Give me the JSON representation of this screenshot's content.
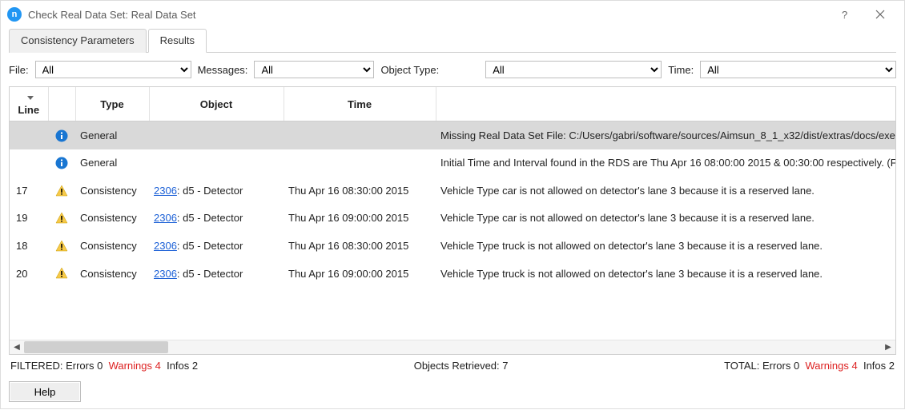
{
  "title": "Check Real Data Set: Real Data Set",
  "tabs": {
    "consistency": "Consistency Parameters",
    "results": "Results"
  },
  "filters": {
    "file_label": "File:",
    "file_value": "All",
    "messages_label": "Messages:",
    "messages_value": "All",
    "object_type_label": "Object Type:",
    "object_type_value": "All",
    "time_label": "Time:",
    "time_value": "All"
  },
  "columns": {
    "line": "Line",
    "icon": "",
    "type": "Type",
    "object": "Object",
    "time": "Time",
    "message": ""
  },
  "rows": [
    {
      "line": "",
      "icon": "info",
      "type": "General",
      "object_link": "",
      "object_rest": "",
      "time": "",
      "message": "Missing Real Data Set File: C:/Users/gabri/software/sources/Aimsun_8_1_x32/dist/extras/docs/exer",
      "hl": true
    },
    {
      "line": "",
      "icon": "info",
      "type": "General",
      "object_link": "",
      "object_rest": "",
      "time": "",
      "message": "Initial Time and Interval found in the RDS are Thu Apr 16 08:00:00 2015 & 00:30:00 respectively. (F",
      "hl": false
    },
    {
      "line": "17",
      "icon": "warn",
      "type": "Consistency",
      "object_link": "2306",
      "object_rest": ": d5 - Detector",
      "time": "Thu Apr 16 08:30:00 2015",
      "message": "Vehicle Type car is not allowed on detector's lane 3 because it is a reserved lane.",
      "hl": false
    },
    {
      "line": "19",
      "icon": "warn",
      "type": "Consistency",
      "object_link": "2306",
      "object_rest": ": d5 - Detector",
      "time": "Thu Apr 16 09:00:00 2015",
      "message": "Vehicle Type car is not allowed on detector's lane 3 because it is a reserved lane.",
      "hl": false
    },
    {
      "line": "18",
      "icon": "warn",
      "type": "Consistency",
      "object_link": "2306",
      "object_rest": ": d5 - Detector",
      "time": "Thu Apr 16 08:30:00 2015",
      "message": "Vehicle Type truck is not allowed on detector's lane 3 because it is a reserved lane.",
      "hl": false
    },
    {
      "line": "20",
      "icon": "warn",
      "type": "Consistency",
      "object_link": "2306",
      "object_rest": ": d5 - Detector",
      "time": "Thu Apr 16 09:00:00 2015",
      "message": "Vehicle Type truck is not allowed on detector's lane 3 because it is a reserved lane.",
      "hl": false
    }
  ],
  "status": {
    "filtered_label": "FILTERED:  Errors 0",
    "filtered_warn": "Warnings 4",
    "filtered_infos": "Infos 2",
    "objects": "Objects Retrieved: 7",
    "total_label": "TOTAL:  Errors 0",
    "total_warn": "Warnings 4",
    "total_infos": "Infos 2"
  },
  "help_label": "Help"
}
